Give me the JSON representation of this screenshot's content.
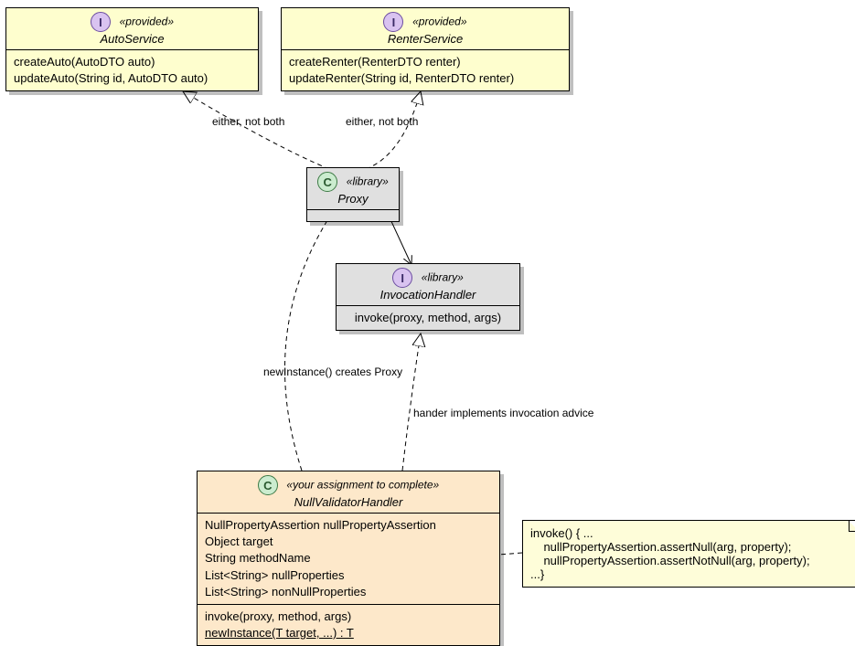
{
  "autoService": {
    "stereotype": "«provided»",
    "name": "AutoService",
    "methods": [
      "createAuto(AutoDTO auto)",
      "updateAuto(String id, AutoDTO auto)"
    ]
  },
  "renterService": {
    "stereotype": "«provided»",
    "name": "RenterService",
    "methods": [
      "createRenter(RenterDTO renter)",
      "updateRenter(String id, RenterDTO renter)"
    ]
  },
  "proxy": {
    "stereotype": "«library»",
    "name": "Proxy"
  },
  "invocationHandler": {
    "stereotype": "«library»",
    "name": "InvocationHandler",
    "methods": [
      "invoke(proxy, method, args)"
    ]
  },
  "nullValidatorHandler": {
    "stereotype": "«your assignment to complete»",
    "name": "NullValidatorHandler",
    "fields": [
      "NullPropertyAssertion nullPropertyAssertion",
      "Object target",
      "String methodName",
      "List<String> nullProperties",
      "List<String> nonNullProperties"
    ],
    "methods": {
      "m1": "invoke(proxy, method, args)",
      "m2": "newInstance(T target, ...) : T"
    }
  },
  "note": {
    "l1": "invoke() { ...",
    "l2": "    nullPropertyAssertion.assertNull(arg, property);",
    "l3": "    nullPropertyAssertion.assertNotNull(arg, property);",
    "l4": "...}"
  },
  "labels": {
    "eitherNotBoth1": "either, not both",
    "eitherNotBoth2": "either, not both",
    "newInstance": "newInstance() creates Proxy",
    "handlerImpl": "hander implements invocation advice"
  }
}
